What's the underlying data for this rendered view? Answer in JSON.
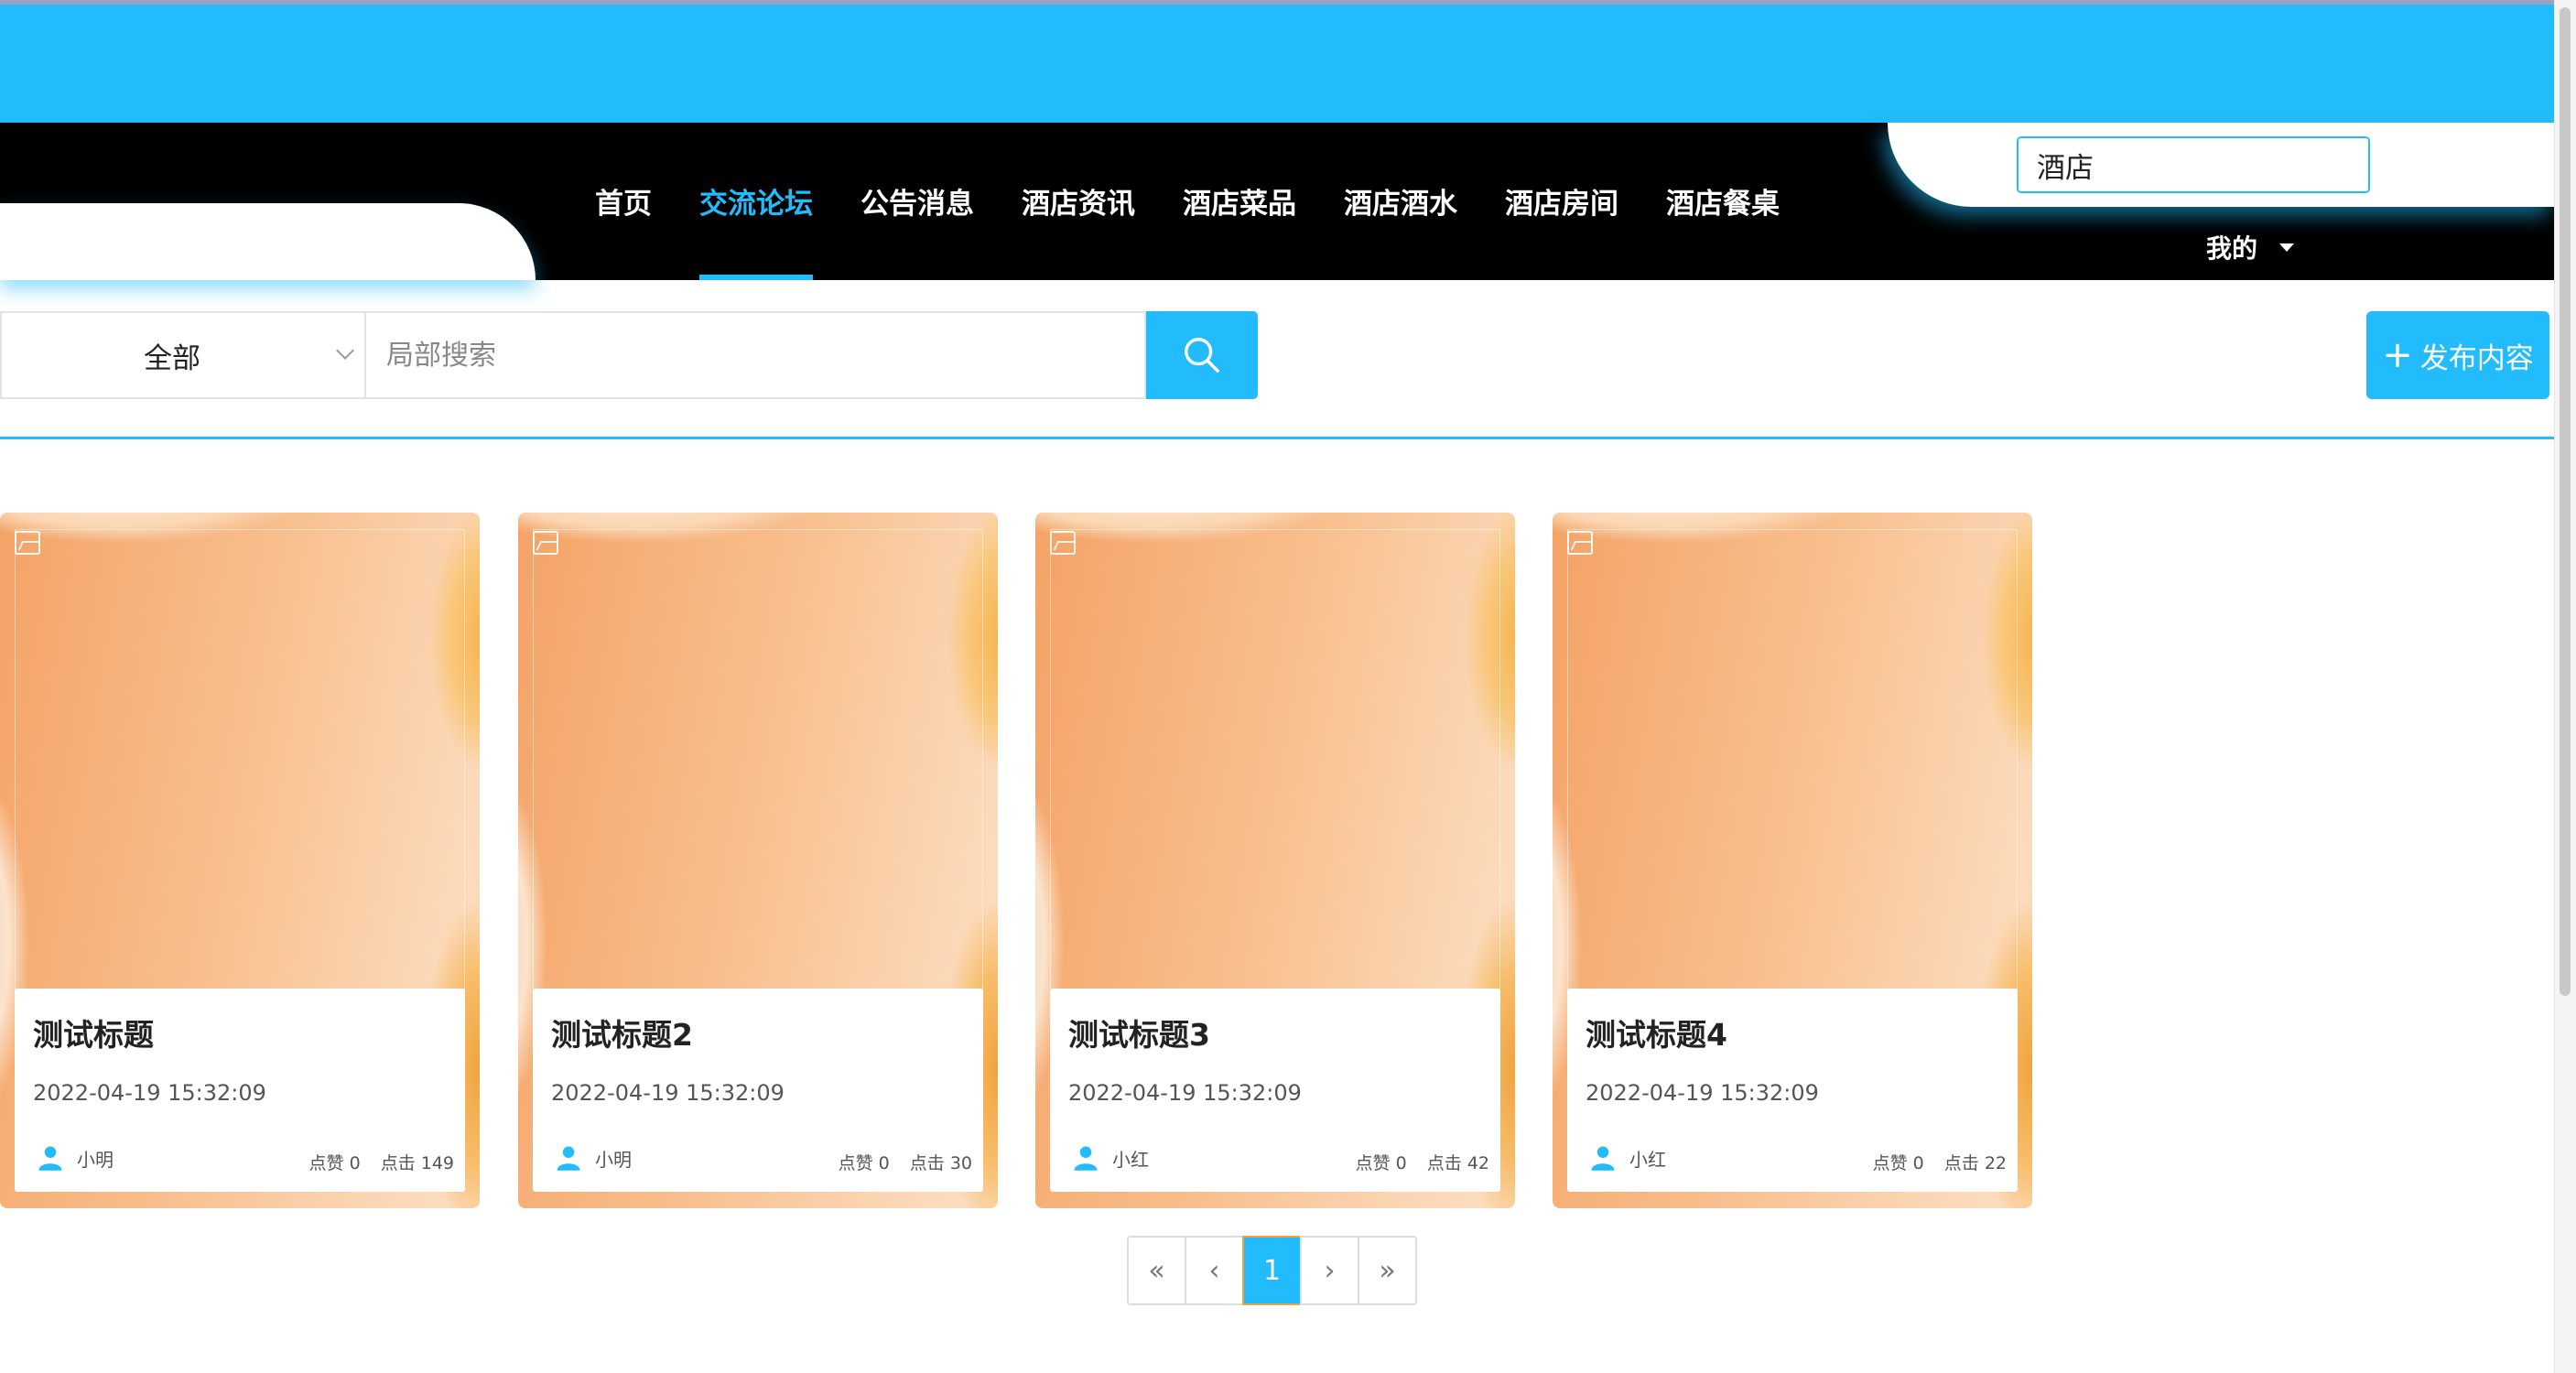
{
  "nav": {
    "items": [
      {
        "label": "首页",
        "active": false
      },
      {
        "label": "交流论坛",
        "active": true
      },
      {
        "label": "公告消息",
        "active": false
      },
      {
        "label": "酒店资讯",
        "active": false
      },
      {
        "label": "酒店菜品",
        "active": false
      },
      {
        "label": "酒店酒水",
        "active": false
      },
      {
        "label": "酒店房间",
        "active": false
      },
      {
        "label": "酒店餐桌",
        "active": false
      }
    ],
    "my_label": "我的"
  },
  "top_search": {
    "value": "酒店",
    "icon": "search-icon"
  },
  "filter": {
    "category_selected": "全部",
    "search_placeholder": "局部搜索",
    "publish_label": "发布内容"
  },
  "posts": [
    {
      "title": "测试标题",
      "date": "2022-04-19 15:32:09",
      "author": "小明",
      "likes": "点赞 0",
      "clicks": "点击 149"
    },
    {
      "title": "测试标题2",
      "date": "2022-04-19 15:32:09",
      "author": "小明",
      "likes": "点赞 0",
      "clicks": "点击 30"
    },
    {
      "title": "测试标题3",
      "date": "2022-04-19 15:32:09",
      "author": "小红",
      "likes": "点赞 0",
      "clicks": "点击 42"
    },
    {
      "title": "测试标题4",
      "date": "2022-04-19 15:32:09",
      "author": "小红",
      "likes": "点赞 0",
      "clicks": "点击 22"
    }
  ],
  "pagination": {
    "first": "«",
    "prev": "‹",
    "current": "1",
    "next": "›",
    "last": "»"
  },
  "colors": {
    "accent": "#22bbfb",
    "nav_bg": "#000000"
  }
}
